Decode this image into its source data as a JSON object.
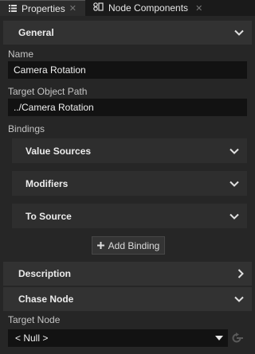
{
  "tabs": [
    {
      "label": "Properties",
      "icon": "list-icon",
      "active": true
    },
    {
      "label": "Node Components",
      "icon": "components-icon",
      "active": false
    }
  ],
  "sections": {
    "general": {
      "title": "General"
    },
    "description": {
      "title": "Description"
    },
    "chase_node": {
      "title": "Chase Node"
    }
  },
  "fields": {
    "name": {
      "label": "Name",
      "value": "Camera Rotation"
    },
    "target_object_path": {
      "label": "Target Object Path",
      "value": "../Camera Rotation"
    },
    "bindings": {
      "label": "Bindings"
    },
    "target_node": {
      "label": "Target Node",
      "value": "< Null >"
    }
  },
  "bindings": {
    "subsections": [
      {
        "title": "Value Sources"
      },
      {
        "title": "Modifiers"
      },
      {
        "title": "To Source"
      }
    ],
    "add_button_label": "Add Binding"
  }
}
